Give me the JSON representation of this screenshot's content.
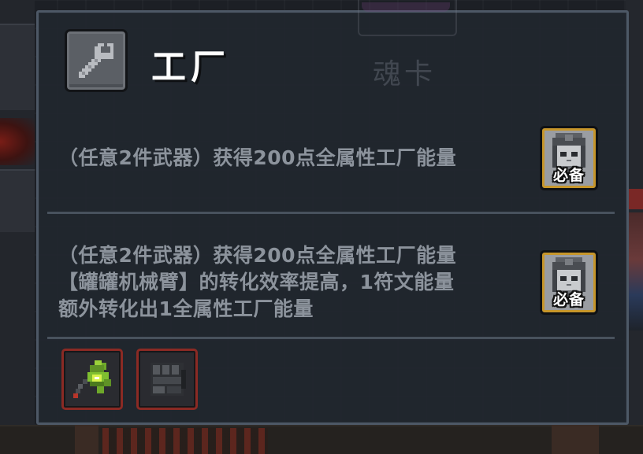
{
  "panel": {
    "title": "工厂",
    "title_icon": "wrench-icon",
    "ghost_card_label": "魂卡"
  },
  "effects": [
    {
      "lines": [
        "（任意2件武器）获得200点全属性工厂能量"
      ],
      "badge_label": "必备"
    },
    {
      "lines": [
        "（任意2件武器）获得200点全属性工厂能量",
        "【罐罐机械臂】的转化效率提高，1符文能量",
        "额外转化出1全属性工厂能量"
      ],
      "badge_label": "必备"
    }
  ],
  "weapons": [
    {
      "icon": "green-mechanical-claw-icon"
    },
    {
      "icon": "dark-gauntlet-icon"
    }
  ],
  "colors": {
    "panel_bg": "#21272f",
    "panel_border": "#4d5866",
    "effect_text": "#8c939c",
    "title_text": "#ffffff",
    "badge_border": "#c7962a",
    "slot_border": "#8b2a24"
  }
}
